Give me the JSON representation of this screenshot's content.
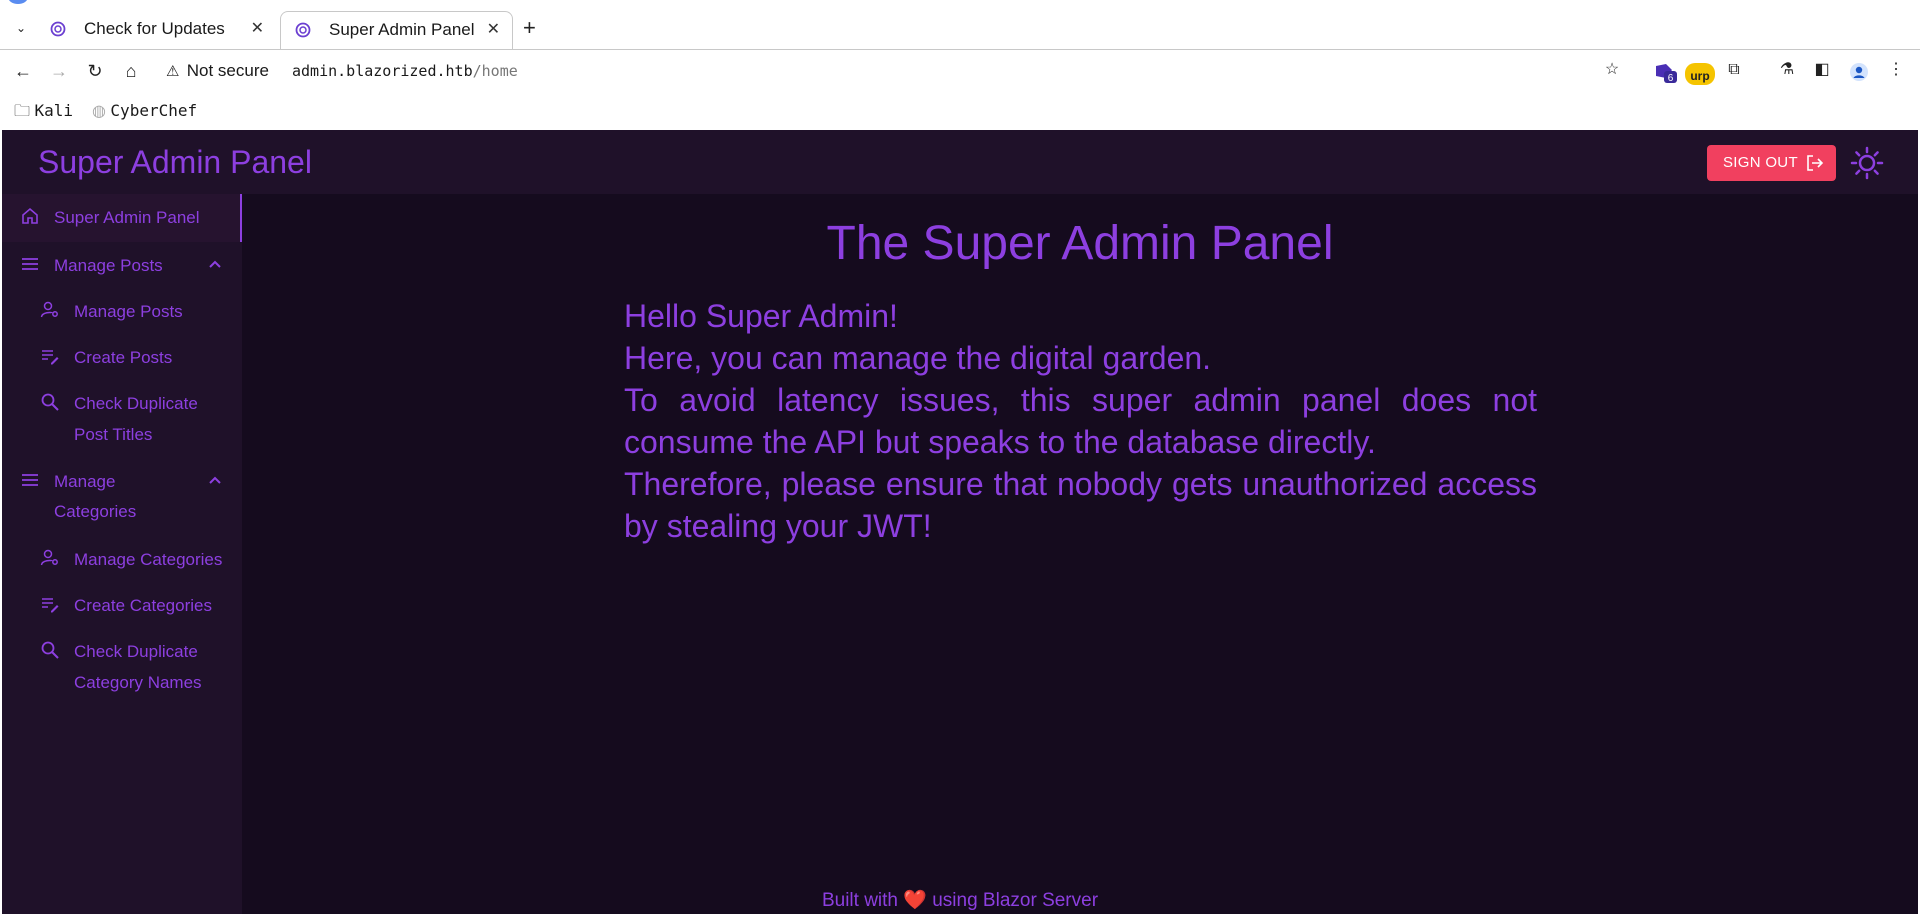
{
  "browser": {
    "tabs": [
      {
        "title": "Check for Updates",
        "active": false
      },
      {
        "title": "Super Admin Panel",
        "active": true
      }
    ],
    "security_label": "Not secure",
    "url_host": "admin.blazorized.htb",
    "url_path": "/home",
    "extension_badge": "6",
    "burp_label": "urp",
    "bookmarks": [
      {
        "label": "Kali",
        "icon": "folder-icon"
      },
      {
        "label": "CyberChef",
        "icon": "cyberchef-icon"
      }
    ]
  },
  "app": {
    "title": "Super Admin Panel",
    "signout_label": "SIGN OUT",
    "sidebar": {
      "home": "Super Admin Panel",
      "posts_group": "Manage Posts",
      "manage_posts": "Manage Posts",
      "create_posts": "Create Posts",
      "check_dup_posts_1": "Check Duplicate",
      "check_dup_posts_2": "Post Titles",
      "categories_group_1": "Manage",
      "categories_group_2": "Categories",
      "manage_categories": "Manage Categories",
      "create_categories": "Create Categories",
      "check_dup_categories_1": "Check Duplicate",
      "check_dup_categories_2": "Category Names"
    },
    "main": {
      "heading": "The Super Admin Panel",
      "line1": "Hello Super Admin!",
      "line2": "Here, you can manage the digital garden.",
      "line3": "To avoid latency issues, this super admin panel does not consume the API but speaks to the database directly.",
      "line4": "Therefore, please ensure that nobody gets unauthorized access by stealing your JWT!"
    },
    "footer": {
      "prefix": "Built with",
      "heart": "❤️",
      "suffix": "using Blazor Server"
    },
    "colors": {
      "accent": "#8d3fe0",
      "background": "#150b1e",
      "surface": "#1f1129",
      "signout": "#f1405f"
    }
  }
}
